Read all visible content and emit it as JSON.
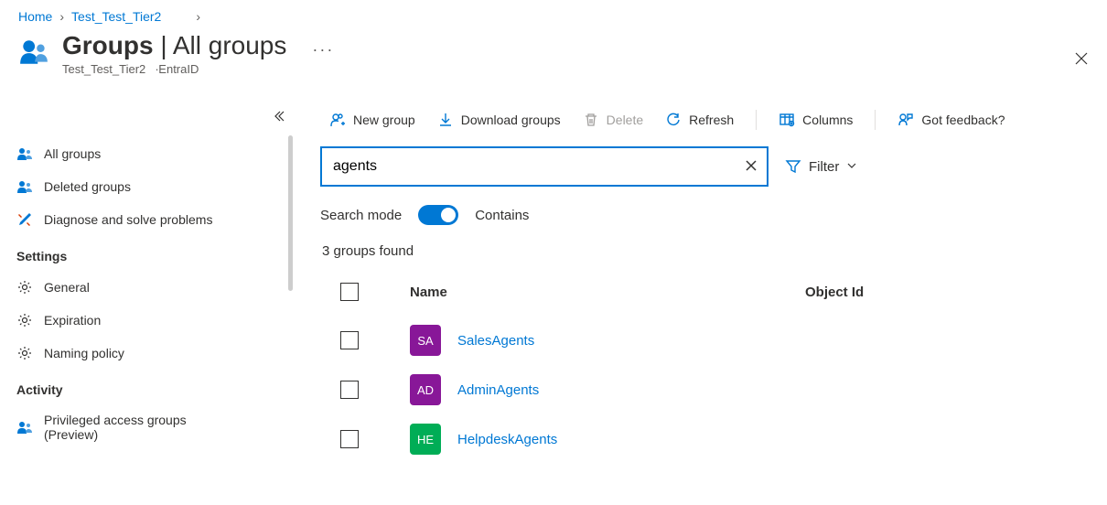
{
  "breadcrumbs": {
    "home": "Home",
    "level1": "Test_Test_Tier2"
  },
  "header": {
    "title_main": "Groups",
    "title_separator": " | ",
    "title_sub": "All groups",
    "subtitle_org": "Test_Test_Tier2",
    "subtitle_product": "EntraID",
    "more": "···"
  },
  "sidebar": {
    "items": [
      {
        "label": "All groups"
      },
      {
        "label": "Deleted groups"
      },
      {
        "label": "Diagnose and solve problems"
      }
    ],
    "settings_head": "Settings",
    "settings": [
      {
        "label": "General"
      },
      {
        "label": "Expiration"
      },
      {
        "label": "Naming policy"
      }
    ],
    "activity_head": "Activity",
    "activity": [
      {
        "label": "Privileged access groups (Preview)"
      }
    ]
  },
  "toolbar": {
    "new_group": "New group",
    "download": "Download groups",
    "delete": "Delete",
    "refresh": "Refresh",
    "columns": "Columns",
    "feedback": "Got feedback?"
  },
  "search": {
    "value": "agents",
    "filter_label": "Filter",
    "mode_label": "Search mode",
    "mode_value": "Contains"
  },
  "results": {
    "count_text": "3 groups found",
    "columns": {
      "name": "Name",
      "object_id": "Object Id"
    },
    "rows": [
      {
        "initials": "SA",
        "name": "SalesAgents",
        "color": "av-purple"
      },
      {
        "initials": "AD",
        "name": "AdminAgents",
        "color": "av-purple"
      },
      {
        "initials": "HE",
        "name": "HelpdeskAgents",
        "color": "av-teal"
      }
    ]
  }
}
